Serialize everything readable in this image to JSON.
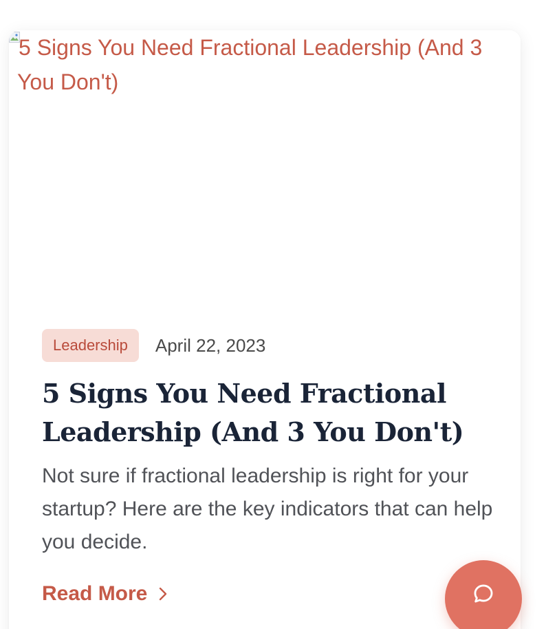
{
  "article": {
    "image_alt": "5 Signs You Need Fractional Leadership (And 3 You Don't)",
    "category": "Leadership",
    "date": "April 22, 2023",
    "title": "5 Signs You Need Fractional Leadership (And 3 You Don't)",
    "excerpt": "Not sure if fractional leadership is right for your startup? Here are the key indicators that can help you decide.",
    "read_more_label": "Read More",
    "read_more_icon": "chevron-right-icon",
    "broken_image_icon": "broken-image-icon"
  },
  "chat": {
    "icon": "chat-bubble-icon"
  },
  "colors": {
    "accent": "#c55a48",
    "badge_bg": "#f7dcd6",
    "chat_button": "#e07262",
    "title": "#1a2437",
    "body_text": "#505257"
  }
}
